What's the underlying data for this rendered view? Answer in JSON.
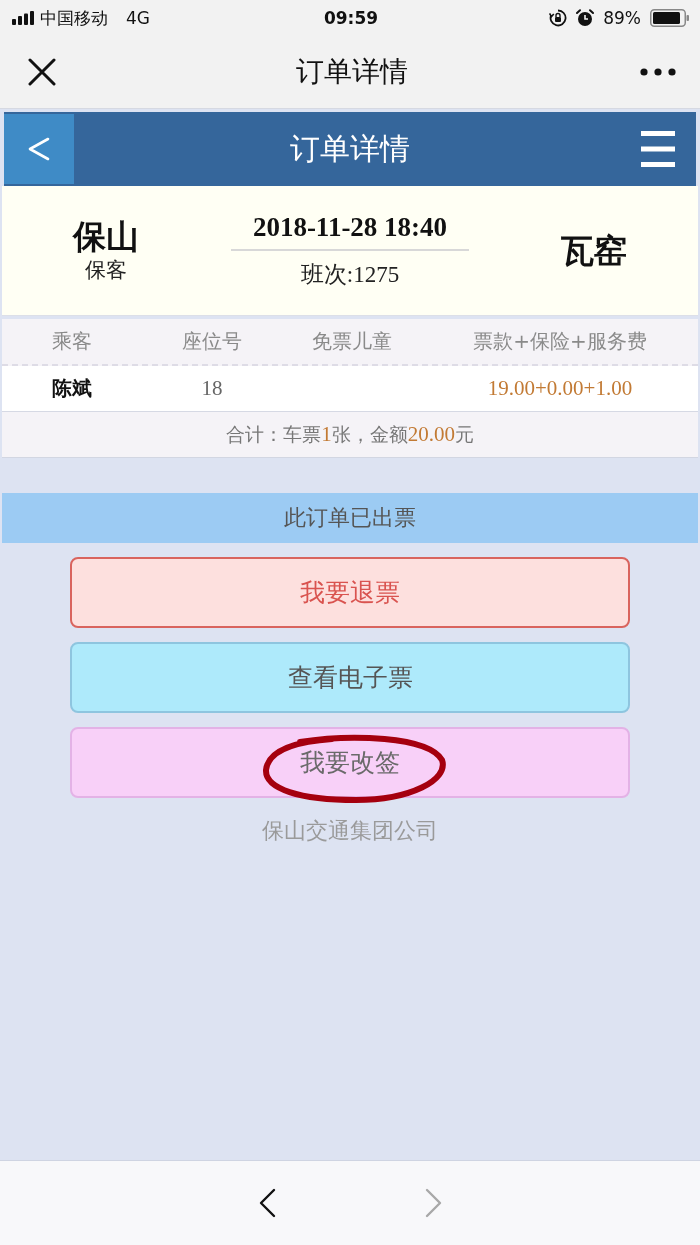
{
  "status_bar": {
    "carrier": "中国移动",
    "network": "4G",
    "time": "09:59",
    "battery": "89%"
  },
  "nav_bar": {
    "title": "订单详情"
  },
  "page_header": {
    "title": "订单详情"
  },
  "trip": {
    "origin": "保山",
    "origin_station": "保客",
    "departure": "2018-11-28 18:40",
    "run_number": "班次:1275",
    "destination": "瓦窑"
  },
  "table": {
    "columns": [
      "乘客",
      "座位号",
      "免票儿童",
      "票款+保险+服务费"
    ],
    "rows": [
      {
        "passenger": "陈斌",
        "seat": "18",
        "fare": "19.00+0.00+1.00"
      }
    ],
    "total": [
      {
        "text": "合计：车票",
        "highlight": false
      },
      {
        "text": "1",
        "highlight": true
      },
      {
        "text": "张，金额",
        "highlight": false
      },
      {
        "text": "20.00",
        "highlight": true
      },
      {
        "text": "元",
        "highlight": false
      }
    ]
  },
  "ticket_status": "此订单已出票",
  "actions": [
    {
      "label": "我要退票",
      "kind": "refund",
      "circled": false
    },
    {
      "label": "查看电子票",
      "kind": "view",
      "circled": false
    },
    {
      "label": "我要改签",
      "kind": "change",
      "circled": true
    }
  ],
  "footer": "保山交通集团公司",
  "browser_toolbar": {
    "buttons": [
      {
        "kind": "back",
        "disabled": false
      },
      {
        "kind": "forward",
        "disabled": true
      }
    ]
  }
}
